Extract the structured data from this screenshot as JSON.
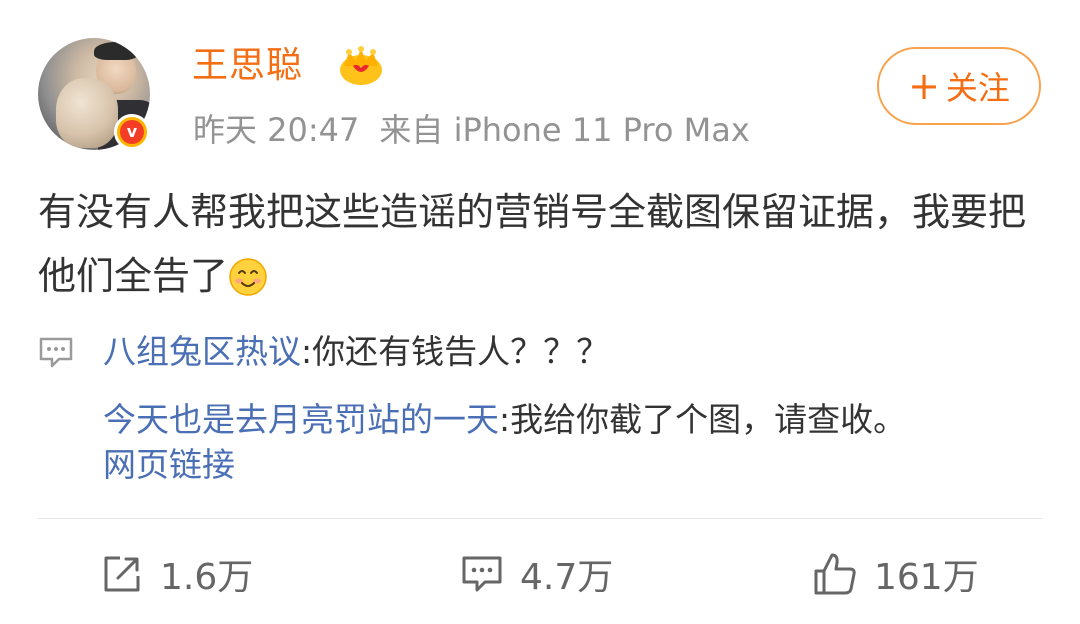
{
  "user": {
    "name": "王思聪",
    "verified_badge": "v",
    "crown_icon": "crown-icon",
    "avatar_alt": "avatar"
  },
  "meta": {
    "time": "昨天 20:47",
    "source": "来自 iPhone 11 Pro Max"
  },
  "follow": {
    "label": "关注",
    "plus": "+"
  },
  "post": {
    "text": "有没有人帮我把这些造谣的营销号全截图保留证据，我要把他们全告了",
    "emoji": "smile-emoji"
  },
  "comments": [
    {
      "nick": "八组兔区热议",
      "text": ":你还有钱告人？？？"
    },
    {
      "nick": "今天也是去月亮罚站的一天",
      "text": ":我给你截了个图，请查收。"
    }
  ],
  "weblink": "网页链接",
  "actions": {
    "repost_count": "1.6万",
    "comment_count": "4.7万",
    "like_count": "161万"
  },
  "colors": {
    "accent": "#f46e14",
    "link": "#4b6fb4",
    "meta": "#939393"
  }
}
